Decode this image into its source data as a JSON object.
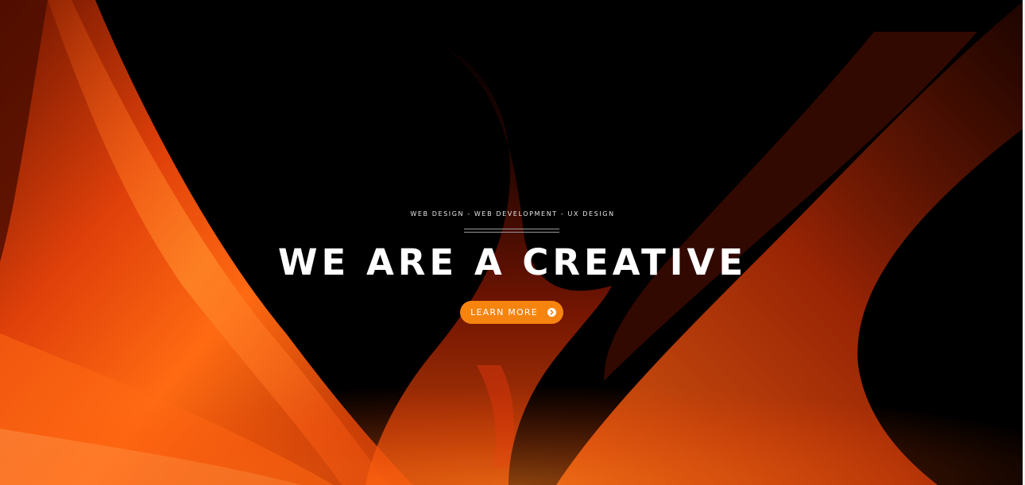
{
  "hero": {
    "tagline": "WEB DESIGN - WEB DEVELOPMENT - UX DESIGN",
    "headline": "WE ARE A CREATIVE",
    "cta": {
      "label": "LEARN MORE",
      "icon": "chevron-circle-right-icon"
    },
    "background": "orange-fractal-flame-image"
  },
  "colors": {
    "accent": "#f7840f",
    "background": "#000000",
    "text": "#ffffff"
  }
}
